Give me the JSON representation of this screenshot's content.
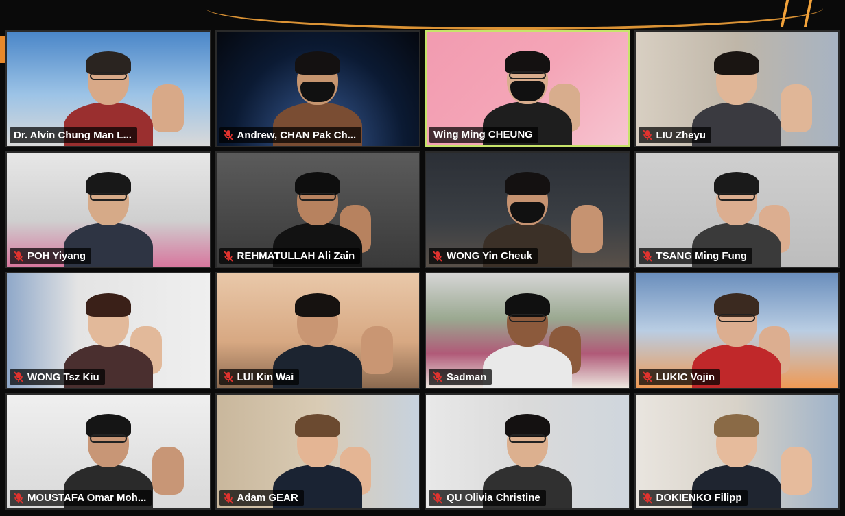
{
  "participants": [
    {
      "name": "Dr. Alvin Chung Man L...",
      "muted": false,
      "active": false,
      "bg": "linear-gradient(180deg,#4a86c8 0%,#9cc3e6 55%,#d9d9d9 100%)",
      "skin": "#d8a988",
      "shirt": "#9a2f2f",
      "hair": "#2a2420",
      "mask": false,
      "glasses": true,
      "hand": true,
      "icon_name": "mic-off-icon"
    },
    {
      "name": "Andrew, CHAN Pak Ch...",
      "muted": true,
      "active": false,
      "bg": "radial-gradient(ellipse at 50% 100%, #3c5f9a 0%, #0b1a33 60%, #05080f 100%)",
      "skin": "#c6956f",
      "shirt": "#7a4d33",
      "hair": "#141111",
      "mask": true,
      "glasses": false,
      "hand": false,
      "icon_name": "mic-off-icon"
    },
    {
      "name": "Wing Ming CHEUNG",
      "muted": false,
      "active": true,
      "bg": "linear-gradient(135deg,#f29bb0 0%,#f4a5b7 50%,#f7c5d1 100%)",
      "skin": "#d8ad8d",
      "shirt": "#1e1e1e",
      "hair": "#141111",
      "mask": true,
      "glasses": true,
      "hand": true,
      "icon_name": "mic-off-icon"
    },
    {
      "name": "LIU Zheyu",
      "muted": true,
      "active": false,
      "bg": "linear-gradient(90deg,#d8cfc2 0%,#bfb6a8 50%,#a7b3c2 100%)",
      "skin": "#e0b697",
      "shirt": "#3a3a40",
      "hair": "#1a1512",
      "mask": false,
      "glasses": false,
      "hand": true,
      "icon_name": "mic-off-icon"
    },
    {
      "name": "POH Yiyang",
      "muted": true,
      "active": false,
      "bg": "linear-gradient(180deg,#e7e7e7 0%,#cfcfcf 60%,#d7779e 100%)",
      "skin": "#d6aa88",
      "shirt": "#2e3443",
      "hair": "#181818",
      "mask": false,
      "glasses": true,
      "hand": false,
      "icon_name": "mic-off-icon"
    },
    {
      "name": "REHMATULLAH Ali Zain",
      "muted": true,
      "active": false,
      "bg": "linear-gradient(180deg,#5b5b5b 0%,#3a3a3a 100%)",
      "skin": "#b7825f",
      "shirt": "#121212",
      "hair": "#0e0e0e",
      "mask": false,
      "glasses": true,
      "hand": true,
      "icon_name": "mic-off-icon"
    },
    {
      "name": "WONG Yin Cheuk",
      "muted": true,
      "active": false,
      "bg": "linear-gradient(180deg,#2b2f36 0%,#3b3f44 60%,#585049 100%)",
      "skin": "#c69371",
      "shirt": "#3b3027",
      "hair": "#141111",
      "mask": true,
      "glasses": false,
      "hand": true,
      "icon_name": "mic-off-icon"
    },
    {
      "name": "TSANG Ming Fung",
      "muted": true,
      "active": false,
      "bg": "linear-gradient(180deg,#cfcfcf 0%,#bdbdbd 100%)",
      "skin": "#dcae90",
      "shirt": "#3a3a3a",
      "hair": "#1a1a1a",
      "mask": false,
      "glasses": true,
      "hand": true,
      "icon_name": "mic-off-icon"
    },
    {
      "name": "WONG Tsz Kiu",
      "muted": true,
      "active": false,
      "bg": "linear-gradient(90deg,#8fa8c9 0%,#e4e4e4 35%,#efefef 100%)",
      "skin": "#e2b99a",
      "shirt": "#4a2f2f",
      "hair": "#3a2018",
      "mask": false,
      "glasses": false,
      "hand": true,
      "icon_name": "mic-off-icon"
    },
    {
      "name": "LUI Kin Wai",
      "muted": true,
      "active": false,
      "bg": "linear-gradient(180deg,#e9c8a9 0%,#d7a882 60%,#8b6a50 100%)",
      "skin": "#c99673",
      "shirt": "#1c2430",
      "hair": "#161210",
      "mask": false,
      "glasses": false,
      "hand": true,
      "icon_name": "mic-off-icon"
    },
    {
      "name": "Sadman",
      "muted": true,
      "active": false,
      "bg": "linear-gradient(180deg,#d5d5d5 0%,#9aa890 40%,#b05a78 70%,#ece6df 100%)",
      "skin": "#8c5a3c",
      "shirt": "#e9e9e9",
      "hair": "#101010",
      "mask": false,
      "glasses": true,
      "hand": true,
      "icon_name": "mic-off-icon"
    },
    {
      "name": "LUKIC Vojin",
      "muted": true,
      "active": false,
      "bg": "linear-gradient(180deg,#6b8fbd 0%,#b9cde3 50%,#ef9a55 100%)",
      "skin": "#dcae90",
      "shirt": "#c0282a",
      "hair": "#3b2a20",
      "mask": false,
      "glasses": true,
      "hand": true,
      "icon_name": "mic-off-icon"
    },
    {
      "name": "MOUSTAFA Omar Moh...",
      "muted": true,
      "active": false,
      "bg": "linear-gradient(180deg,#efefef 0%,#d9d9d9 100%)",
      "skin": "#c89676",
      "shirt": "#2a2a2a",
      "hair": "#151515",
      "mask": false,
      "glasses": true,
      "hand": true,
      "icon_name": "mic-off-icon"
    },
    {
      "name": "Adam GEAR",
      "muted": true,
      "active": false,
      "bg": "linear-gradient(90deg,#c9b79c 0%,#d9cbb4 50%,#c7d2de 100%)",
      "skin": "#e4b594",
      "shirt": "#1a2333",
      "hair": "#6b4a30",
      "mask": false,
      "glasses": false,
      "hand": true,
      "icon_name": "mic-off-icon"
    },
    {
      "name": "QU Olivia Christine",
      "muted": true,
      "active": false,
      "bg": "linear-gradient(90deg,#e8e8e8 0%,#dadada 50%,#cfd6dd 100%)",
      "skin": "#dcb08f",
      "shirt": "#303030",
      "hair": "#141111",
      "mask": false,
      "glasses": true,
      "hand": false,
      "icon_name": "mic-off-icon"
    },
    {
      "name": "DOKIENKO Filipp",
      "muted": true,
      "active": false,
      "bg": "linear-gradient(90deg,#e9e5df 0%,#d8d2c8 50%,#9fb3c9 100%)",
      "skin": "#e6bb9c",
      "shirt": "#1f2530",
      "hair": "#8a6a46",
      "mask": false,
      "glasses": false,
      "hand": true,
      "icon_name": "mic-off-icon"
    }
  ],
  "colors": {
    "active_speaker_border": "#c7e46a",
    "mic_off": "#e0332f",
    "label_bg": "rgba(0,0,0,0.72)",
    "label_text": "#ffffff"
  }
}
